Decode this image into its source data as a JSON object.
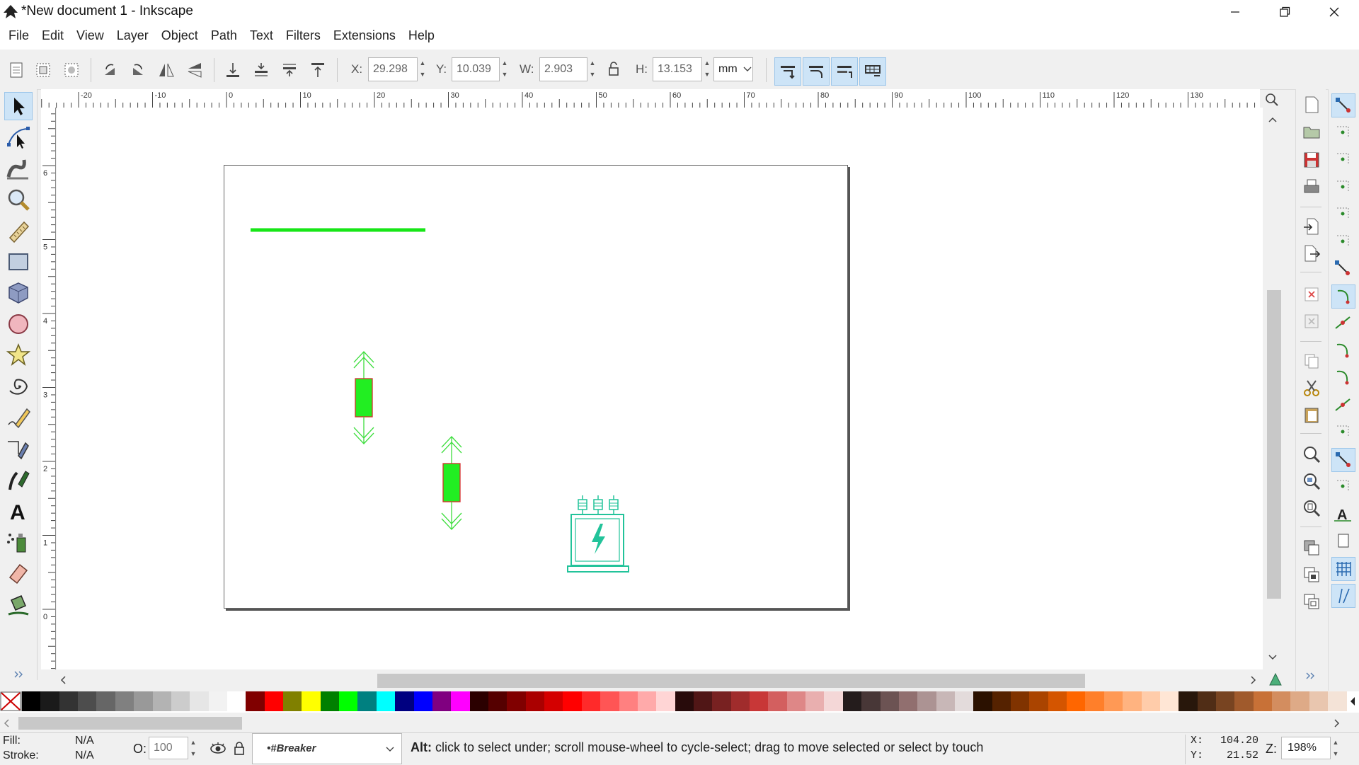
{
  "window": {
    "title": "*New document 1 - Inkscape",
    "icon": "inkscape-logo-icon",
    "controls": [
      "minimize-icon",
      "restore-icon",
      "close-icon"
    ]
  },
  "menu": [
    "File",
    "Edit",
    "View",
    "Layer",
    "Object",
    "Path",
    "Text",
    "Filters",
    "Extensions",
    "Help"
  ],
  "toolbar": {
    "x_label": "X:",
    "x_value": "29.298",
    "y_label": "Y:",
    "y_value": "10.039",
    "w_label": "W:",
    "w_value": "2.903",
    "h_label": "H:",
    "h_value": "13.153",
    "unit": "mm",
    "left_icons": [
      "select-all-icon",
      "select-all-layers-icon",
      "deselect-icon",
      "rotate-ccw-icon",
      "rotate-cw-icon",
      "flip-horizontal-icon",
      "flip-vertical-icon",
      "lower-to-bottom-icon",
      "lower-icon",
      "raise-icon",
      "raise-to-top-icon"
    ],
    "right_toggles": [
      "scale-stroke-icon",
      "scale-corners-icon",
      "transform-gradients-icon",
      "transform-patterns-icon"
    ]
  },
  "tools": [
    "selector-tool-icon",
    "node-tool-icon",
    "tweak-tool-icon",
    "zoom-tool-icon",
    "measure-tool-icon",
    "rectangle-tool-icon",
    "3d-box-tool-icon",
    "ellipse-tool-icon",
    "star-tool-icon",
    "spiral-tool-icon",
    "pencil-tool-icon",
    "pen-tool-icon",
    "calligraphy-tool-icon",
    "text-tool-icon",
    "spray-tool-icon",
    "eraser-tool-icon",
    "paint-bucket-tool-icon"
  ],
  "ruler": {
    "h_labels": [
      "-20",
      "-10",
      "0",
      "10",
      "20",
      "30",
      "40",
      "50",
      "60",
      "70",
      "80",
      "90",
      "100",
      "110",
      "120",
      "130"
    ],
    "v_labels": [
      "6",
      "5",
      "4",
      "3",
      "2",
      "1",
      "0"
    ]
  },
  "canvas": {
    "objects": [
      "green-line",
      "breaker-symbol-1",
      "breaker-symbol-2",
      "transformer-symbol"
    ]
  },
  "commands_bar": [
    "new-document-icon",
    "open-icon",
    "save-icon",
    "print-icon",
    "import-icon",
    "export-icon",
    "undo-icon",
    "redo-icon",
    "copy-icon",
    "cut-icon",
    "paste-icon",
    "zoom-selection-icon",
    "zoom-drawing-icon",
    "zoom-page-icon",
    "duplicate-icon",
    "clone-icon",
    "unlink-clone-icon"
  ],
  "snap_bar": [
    "snap-toggle-icon",
    "snap-bbox-icon",
    "snap-bbox-edge-icon",
    "snap-bbox-corner-icon",
    "snap-bbox-midpoint-icon",
    "snap-bbox-center-icon",
    "snap-nodes-icon",
    "snap-path-icon",
    "snap-intersection-icon",
    "snap-cusp-icon",
    "snap-smooth-icon",
    "snap-line-midpoint-icon",
    "snap-others-icon",
    "snap-center-icon",
    "snap-rotation-center-icon",
    "snap-text-baseline-icon",
    "snap-page-border-icon",
    "snap-grid-icon",
    "snap-guide-icon"
  ],
  "palette": {
    "none_icon": "no-paint-icon",
    "colors": [
      "#000000",
      "#1a1a1a",
      "#333333",
      "#4d4d4d",
      "#666666",
      "#808080",
      "#999999",
      "#b3b3b3",
      "#cccccc",
      "#e6e6e6",
      "#f2f2f2",
      "#ffffff",
      "#800000",
      "#ff0000",
      "#808000",
      "#ffff00",
      "#008000",
      "#00ff00",
      "#008080",
      "#00ffff",
      "#000080",
      "#0000ff",
      "#800080",
      "#ff00ff",
      "#2b0000",
      "#550000",
      "#800000",
      "#aa0000",
      "#d40000",
      "#ff0000",
      "#ff2a2a",
      "#ff5555",
      "#ff8080",
      "#ffaaaa",
      "#ffd5d5",
      "#280b0b",
      "#501616",
      "#782121",
      "#a02c2c",
      "#c83737",
      "#d35f5f",
      "#de8787",
      "#e9afaf",
      "#f4d7d7",
      "#241c1c",
      "#483737",
      "#6c5353",
      "#916f6f",
      "#ac9393",
      "#c8b7b7",
      "#e3dbdb",
      "#2b1100",
      "#552200",
      "#803300",
      "#aa4400",
      "#d45500",
      "#ff6600",
      "#ff7f2a",
      "#ff9955",
      "#ffb380",
      "#ffccaa",
      "#ffe6d5",
      "#28170b",
      "#502d16",
      "#784421",
      "#a05a2c",
      "#c87137",
      "#d38d5f",
      "#deaa87",
      "#e9c6af",
      "#f4e3d7"
    ]
  },
  "status": {
    "fill_label": "Fill:",
    "fill_value": "N/A",
    "stroke_label": "Stroke:",
    "stroke_value": "N/A",
    "opacity_label": "O:",
    "opacity_value": "100",
    "layer": "•#Breaker",
    "message": "Alt: click to select under; scroll mouse-wheel to cycle-select; drag to move selected or select by touch",
    "cursor_x_label": "X:",
    "cursor_x": "104.20",
    "cursor_y_label": "Y:",
    "cursor_y": "21.52",
    "zoom_label": "Z:",
    "zoom": "198%"
  }
}
